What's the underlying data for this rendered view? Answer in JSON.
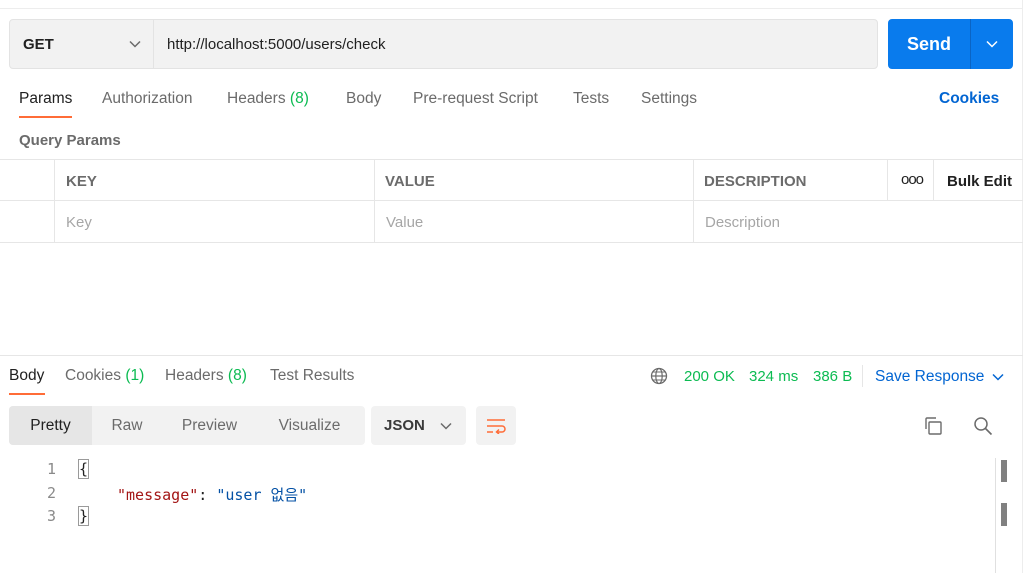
{
  "request": {
    "method": "GET",
    "url": "http://localhost:5000/users/check",
    "send_label": "Send"
  },
  "request_tabs": [
    {
      "label": "Params",
      "count": ""
    },
    {
      "label": "Authorization",
      "count": ""
    },
    {
      "label": "Headers",
      "count": "(8)"
    },
    {
      "label": "Body",
      "count": ""
    },
    {
      "label": "Pre-request Script",
      "count": ""
    },
    {
      "label": "Tests",
      "count": ""
    },
    {
      "label": "Settings",
      "count": ""
    }
  ],
  "cookies_link": "Cookies",
  "query_params": {
    "title": "Query Params",
    "headers": {
      "key": "KEY",
      "value": "VALUE",
      "description": "DESCRIPTION"
    },
    "more": "ooo",
    "bulk_edit": "Bulk Edit",
    "placeholders": {
      "key": "Key",
      "value": "Value",
      "description": "Description"
    }
  },
  "response_tabs": [
    {
      "label": "Body",
      "count": ""
    },
    {
      "label": "Cookies",
      "count": "(1)"
    },
    {
      "label": "Headers",
      "count": "(8)"
    },
    {
      "label": "Test Results",
      "count": ""
    }
  ],
  "response_status": {
    "status": "200 OK",
    "time": "324 ms",
    "size": "386 B",
    "save_label": "Save Response"
  },
  "view_modes": [
    "Pretty",
    "Raw",
    "Preview",
    "Visualize"
  ],
  "format": "JSON",
  "code": {
    "line_numbers": [
      "1",
      "2",
      "3"
    ],
    "open_brace": "{",
    "close_brace": "}",
    "key": "\"message\"",
    "colon": ": ",
    "value": "\"user 없음\""
  },
  "colors": {
    "accent": "#ff6c37",
    "send": "#097bed",
    "link": "#0265d2",
    "success": "#0cbb52"
  }
}
